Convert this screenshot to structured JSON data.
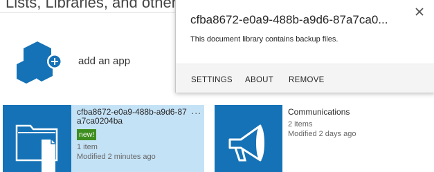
{
  "section": {
    "heading": "Lists, Libraries, and other Apps"
  },
  "add_app": {
    "label": "add an app",
    "icon": "add-app-hexagon-icon"
  },
  "tiles": [
    {
      "title": "cfba8672-e0a9-488b-a9d6-87a7ca0204ba",
      "badge": "new!",
      "count": "1 item",
      "modified": "Modified 2 minutes ago",
      "icon": "document-library-icon",
      "menu": "..."
    },
    {
      "title": "Communications",
      "count": "2 items",
      "modified": "Modified 2 days ago",
      "icon": "megaphone-icon"
    }
  ],
  "callout": {
    "title": "cfba8672-e0a9-488b-a9d6-87a7ca0...",
    "description": "This document library contains backup files.",
    "actions": [
      "SETTINGS",
      "ABOUT",
      "REMOVE"
    ],
    "close_icon": "close-icon"
  },
  "colors": {
    "tile_icon_bg": "#1572b6",
    "selected_tile_bg": "#c4e2f6",
    "new_badge_bg": "#3e8e1f",
    "callout_footer_bg": "#f4f4f4",
    "hex_icon": "#1572b6"
  }
}
